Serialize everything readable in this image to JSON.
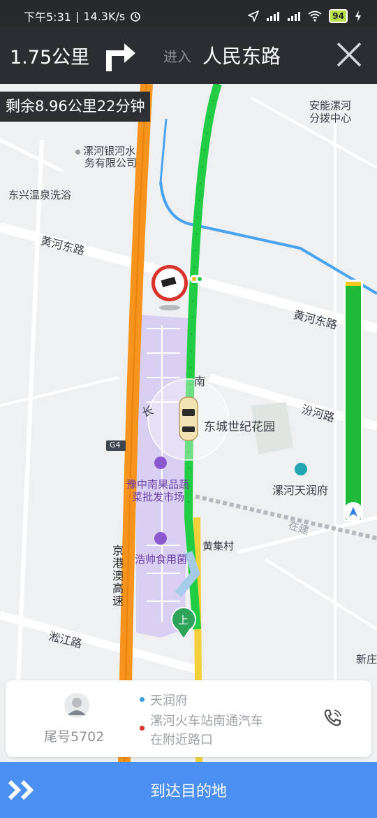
{
  "status_bar": {
    "time": "下午5:31",
    "speed": "14.3K/s",
    "battery": "94",
    "icons": [
      "alarm-icon",
      "location-icon",
      "signal-icon",
      "signal-icon",
      "wifi-icon",
      "battery-icon",
      "charging-icon"
    ]
  },
  "nav": {
    "distance": "1.75公里",
    "turn_icon": "turn-right-icon",
    "enter_label": "进入",
    "road_name": "人民东路",
    "close_icon": "close-icon"
  },
  "remaining": "剩余8.96公里22分钟",
  "map": {
    "labels": {
      "anneng": "安能漯河",
      "anneng2": "分拨中心",
      "yinhe": "漯河银河水",
      "yinhe2": "务有限公司",
      "dongxing": "东兴温泉洗浴",
      "huanghe1": "黄河东路",
      "huanghe2": "黄河东路",
      "fenhe": "汾河路",
      "dongcheng": "东城世纪花园",
      "tianrun": "漯河天润府",
      "yuzhong": "豫中南果品蔬",
      "yuzhong2": "菜批发市场",
      "haoshuai": "浩帅食用菌",
      "huangji": "黄集村",
      "zaijian": "在建",
      "songjiang": "淞江路",
      "xinzhuang": "新庄",
      "highway": "京港澳高速",
      "g4": "G4",
      "nan": "南",
      "chang": "长",
      "pickup": "上"
    },
    "colors": {
      "route": "#22cc44",
      "highway": "#f7941d",
      "water": "#4aa3f0",
      "district": "#d9cff2",
      "yellow_road": "#f3d03a"
    }
  },
  "traffic_bar": {
    "icon": "navigation-arrow-icon",
    "colors": {
      "clear": "#1fbb38",
      "slow": "#f3c91d"
    }
  },
  "card": {
    "avatar_icon": "user-avatar-icon",
    "tail_number": "尾号5702",
    "from": "天润府",
    "to": "漯河火车站南通汽车在附近路口",
    "to_line1": "漯河火车站南通汽车",
    "to_line2": "在附近路口",
    "from_dot_color": "#3aa0e6",
    "to_dot_color": "#d9342b",
    "phone_icon": "phone-icon"
  },
  "bottom": {
    "label": "到达目的地",
    "icon": "double-chevron-icon"
  }
}
